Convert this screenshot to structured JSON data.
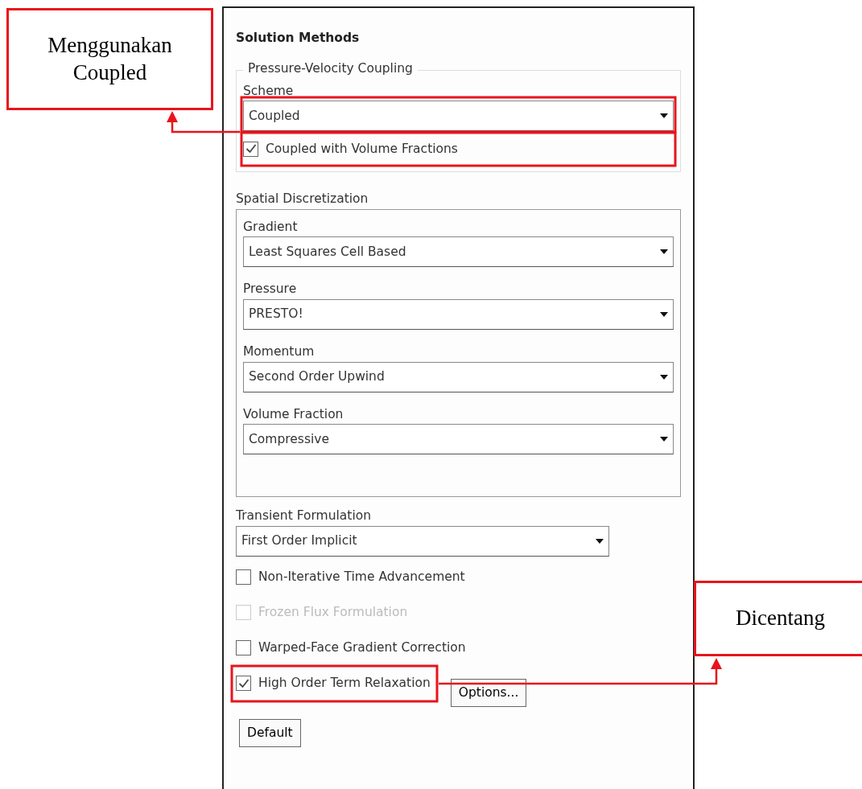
{
  "callouts": [
    {
      "text": "Menggunakan Coupled"
    },
    {
      "text": "Dicentang"
    }
  ],
  "panel": {
    "title": "Solution Methods",
    "pressure_velocity_coupling": {
      "title": "Pressure-Velocity Coupling",
      "scheme_label": "Scheme",
      "scheme": "Coupled",
      "option": {
        "label": "Coupled with Volume Fractions",
        "checked": true
      }
    },
    "spatial_discretization": {
      "title": "Spatial Discretization",
      "fields": [
        {
          "label": "Gradient",
          "value": "Least Squares Cell Based"
        },
        {
          "label": "Pressure",
          "value": "PRESTO!"
        },
        {
          "label": "Momentum",
          "value": "Second Order Upwind"
        },
        {
          "label": "Volume Fraction",
          "value": "Compressive"
        }
      ]
    },
    "transient_formulation": {
      "label": "Transient Formulation",
      "value": "First Order Implicit"
    },
    "options": [
      {
        "label": "Non-Iterative Time Advancement",
        "checked": false,
        "disabled": false
      },
      {
        "label": "Frozen Flux Formulation",
        "checked": false,
        "disabled": true
      },
      {
        "label": "Warped-Face Gradient Correction",
        "checked": false,
        "disabled": false
      },
      {
        "label": "High Order Term Relaxation",
        "checked": true,
        "disabled": false,
        "button": "Options..."
      }
    ],
    "default_button": "Default"
  }
}
